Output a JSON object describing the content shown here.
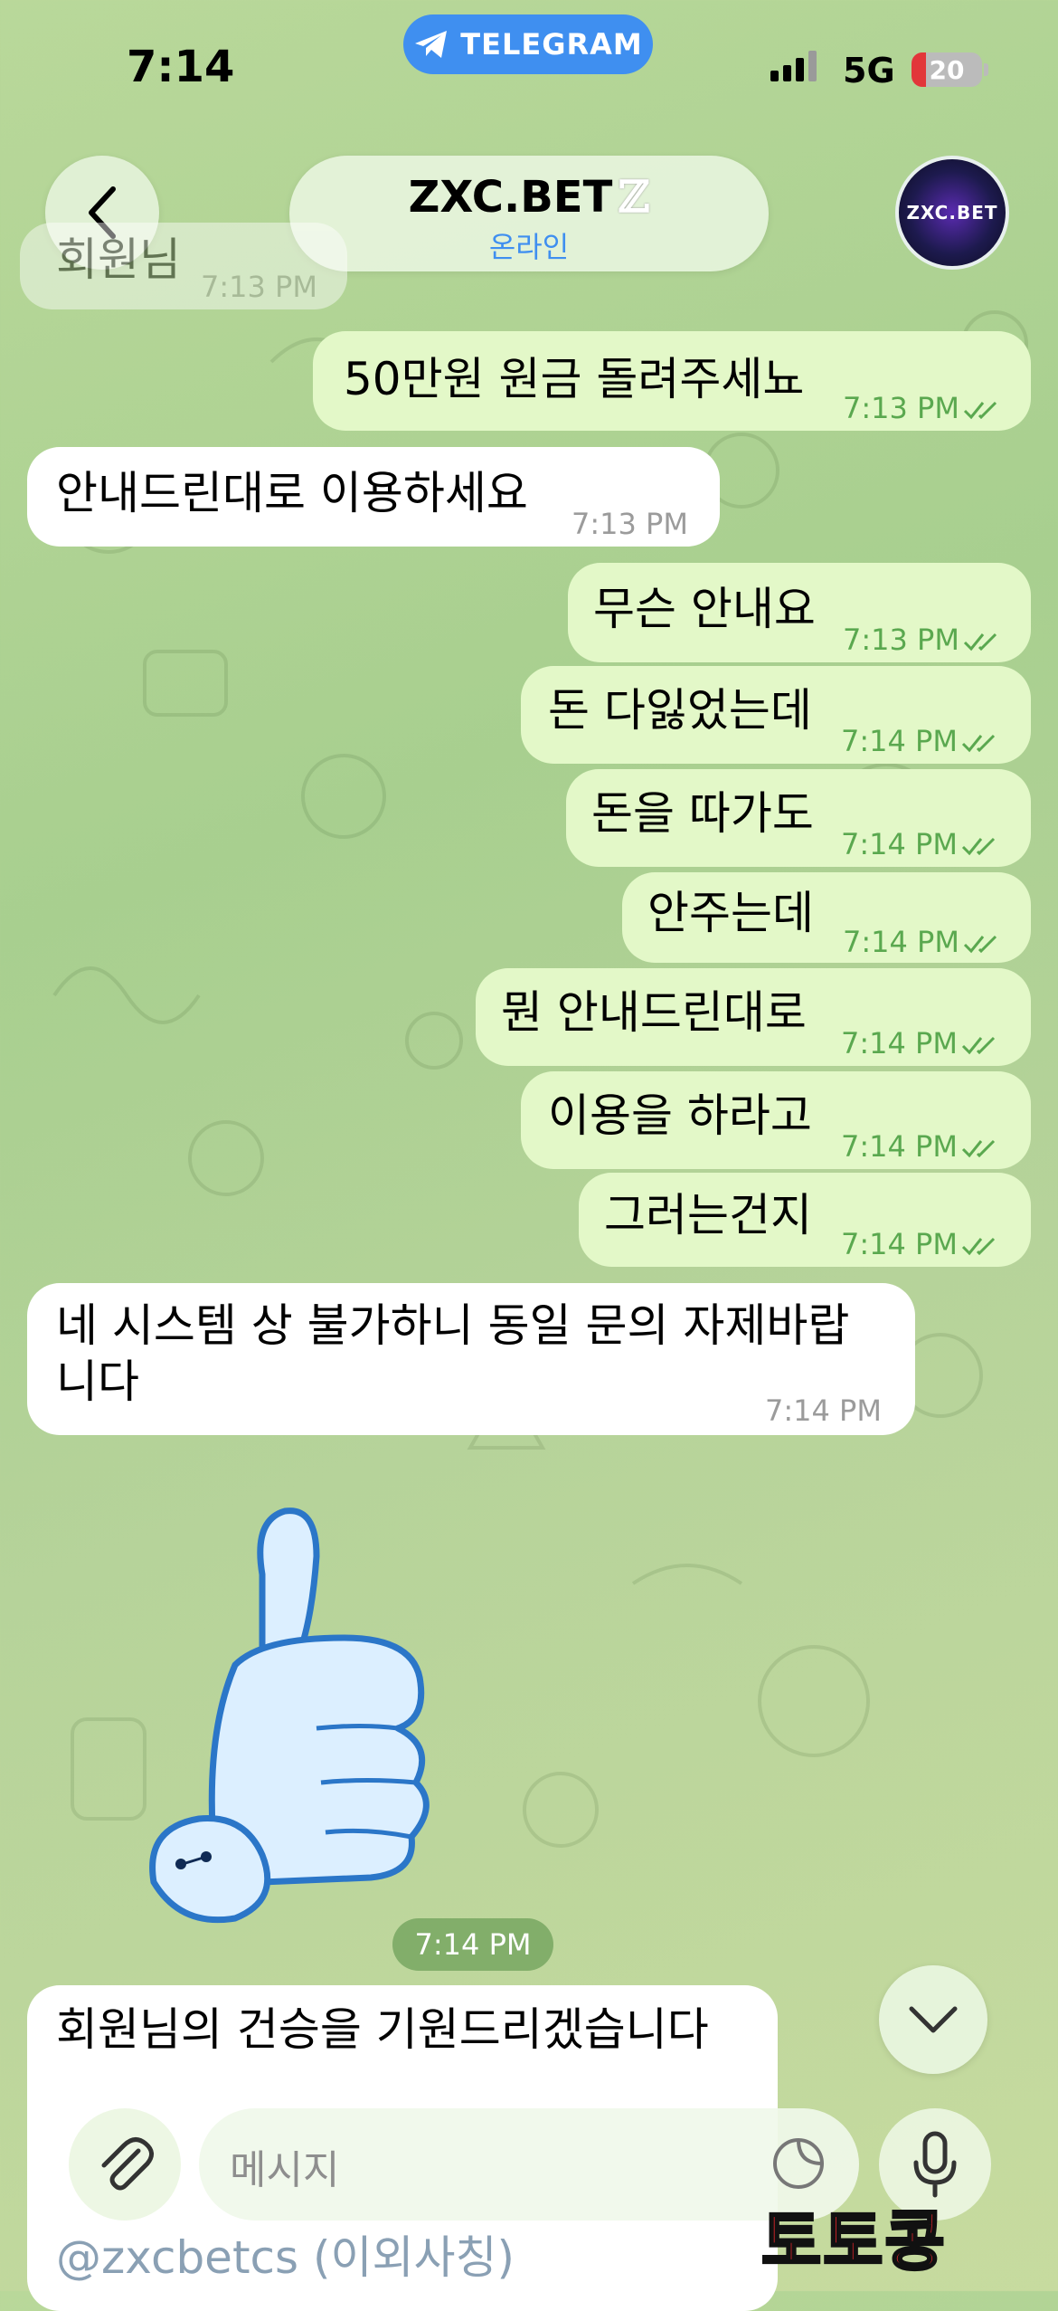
{
  "status_bar": {
    "time": "7:14",
    "app_pill": "TELEGRAM",
    "network": "5G",
    "battery": "20"
  },
  "header": {
    "title": "ZXC.BET",
    "title_emoji": "ℤ",
    "status": "온라인",
    "avatar_text": "ZXC.BET"
  },
  "messages": [
    {
      "dir": "in",
      "text": "회원님",
      "time": "7:13 PM"
    },
    {
      "dir": "out",
      "text": "50만원 원금 돌려주세뇨",
      "time": "7:13 PM"
    },
    {
      "dir": "in",
      "text": "안내드린대로 이용하세요",
      "time": "7:13 PM"
    },
    {
      "dir": "out",
      "text": "무슨 안내요",
      "time": "7:13 PM"
    },
    {
      "dir": "out",
      "text": "돈 다잃었는데",
      "time": "7:14 PM"
    },
    {
      "dir": "out",
      "text": "돈을 따가도",
      "time": "7:14 PM"
    },
    {
      "dir": "out",
      "text": "안주는데",
      "time": "7:14 PM"
    },
    {
      "dir": "out",
      "text": "뭔 안내드린대로",
      "time": "7:14 PM"
    },
    {
      "dir": "out",
      "text": "이용을 하라고",
      "time": "7:14 PM"
    },
    {
      "dir": "out",
      "text": "그러는건지",
      "time": "7:14 PM"
    },
    {
      "dir": "in",
      "text_line1": "네 시스템 상 불가하니 동일 문의 자제바랍",
      "text_line2": "니다",
      "time": "7:14 PM"
    },
    {
      "dir": "in",
      "text": "회원님의 건승을 기원드리겠습니다",
      "line2": "@zxcbetcs (이외사칭)"
    }
  ],
  "sticker": {
    "name": "thumbs-up",
    "time": "7:14 PM"
  },
  "input": {
    "placeholder": "메시지"
  },
  "watermark": "토토콩",
  "colors": {
    "accent": "#3f8ff0",
    "outgoing": "#e3f8c8",
    "incoming": "#ffffff",
    "read_tick": "#5aa84f"
  }
}
